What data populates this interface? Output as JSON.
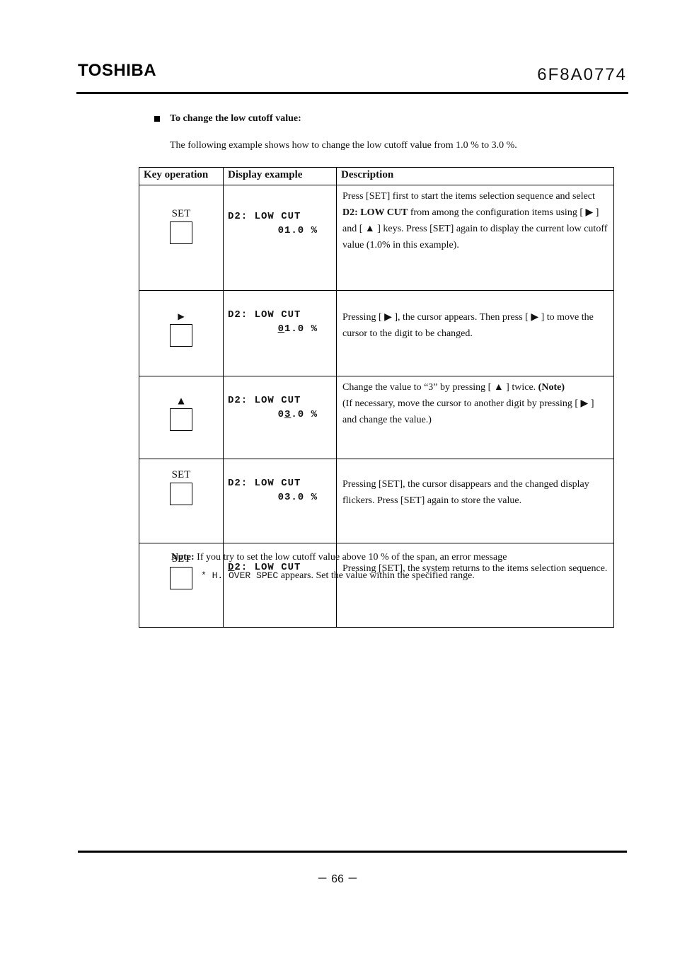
{
  "header": {
    "brand": "TOSHIBA",
    "doc_number": "6F8A0774"
  },
  "section": {
    "title": "To change the low cutoff value:",
    "intro": "The following example shows how to change the low cutoff value from 1.0 % to 3.0 %."
  },
  "table": {
    "headers": [
      "Key operation",
      "Display example",
      "Description"
    ],
    "rows": [
      {
        "key_label": "SET",
        "key_type": "text",
        "display_line1": "D2: LOW CUT",
        "display_line2": "01.0 %",
        "description_parts": [
          {
            "text": "Press [SET] first to start the items selection sequence and select ",
            "bold": false
          },
          {
            "text": "D2: LOW CUT",
            "bold": true
          },
          {
            "text": " from among the configuration items using [ ▶ ] and [ ▲ ] keys. Press [SET] again to display the current low cutoff value (1.0% in this example).",
            "bold": false
          }
        ]
      },
      {
        "key_label": "▶",
        "key_type": "right-arrow-icon",
        "display_line1": "D2: LOW CUT",
        "display_line2_underlined": "0",
        "display_line2_rest": "1.0 %",
        "description": "Pressing [ ▶ ], the cursor appears. Then press [ ▶ ] to move the cursor to the digit to be changed."
      },
      {
        "key_label": "▲",
        "key_type": "up-arrow-icon",
        "display_line1": "D2: LOW CUT",
        "display_line2_pre": "0",
        "display_line2_underlined": "3",
        "display_line2_rest": ".0 %",
        "description_main": "Change the value to “3” by pressing [ ▲ ] twice. ",
        "description_note": "(Note)",
        "description_extra": "(If necessary, move the cursor to another digit by pressing [ ▶ ] and change the value.)"
      },
      {
        "key_label": "SET",
        "key_type": "text",
        "display_line1": "D2: LOW CUT",
        "display_line2": "03.0 %",
        "description": "Pressing [SET], the cursor disappears and the changed display flickers. Press [SET] again to store the value."
      },
      {
        "key_label": "SET",
        "key_type": "text",
        "display_line1_underlined": "D",
        "display_line1_rest": "2: LOW CUT",
        "description": "Pressing [SET], the system returns to the items selection sequence."
      }
    ]
  },
  "note": {
    "label": "Note:",
    "text": " If you try to set the low cutoff value above 10 % of the span, an error message",
    "error_message": "* H.  OVER SPEC",
    "text2": " appears. Set the value within the specified range."
  },
  "footer": {
    "page": "－  66  －"
  }
}
